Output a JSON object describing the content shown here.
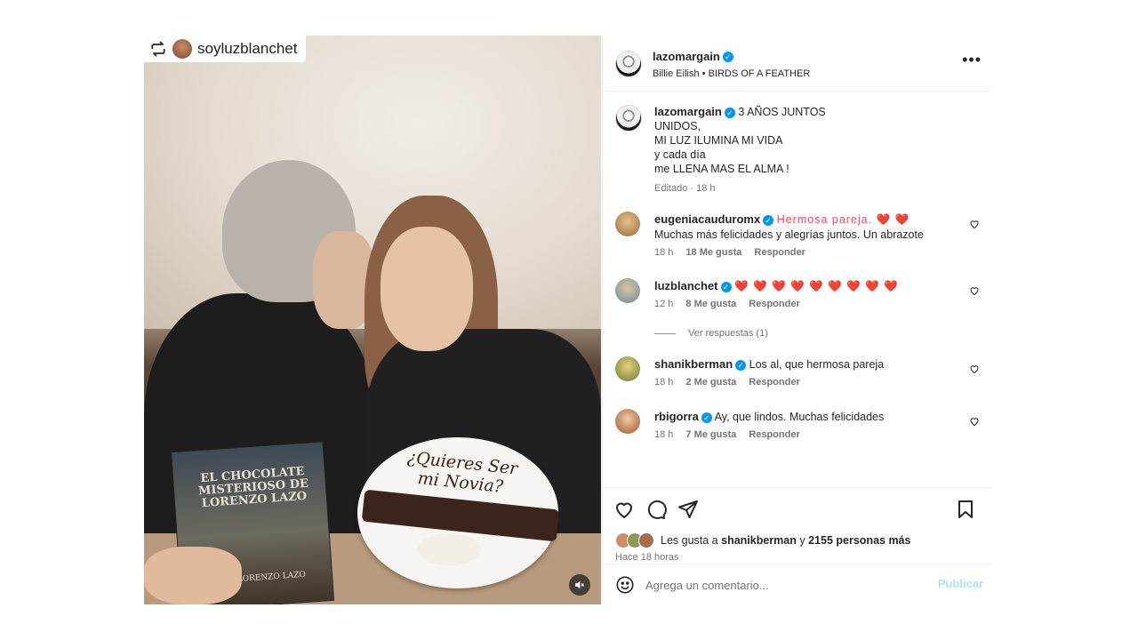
{
  "repost": {
    "username": "soyluzblanchet"
  },
  "photo": {
    "plate_text": "¿Quieres Ser mi Novia?",
    "book_title": "EL CHOCOLATE MISTERIOSO DE LORENZO LAZO",
    "book_author": "DE LORENZO LAZO"
  },
  "header": {
    "username": "lazomargain",
    "artist": "Billie Eilish",
    "song": "BIRDS OF A FEATHER",
    "separator": "•"
  },
  "caption": {
    "username": "lazomargain",
    "lines": [
      "3 AÑOS JUNTOS",
      "UNIDOS,",
      "MI LUZ ILUMINA MI VIDA",
      "y cada día",
      "me LLENA MAS EL ALMA !"
    ],
    "edited": "Editado",
    "dot": "·",
    "time": "18 h"
  },
  "comments": [
    {
      "username": "eugeniacauduromx",
      "text1": "Hermosa pareja. ❤️ ❤️",
      "text2": "Muchas más felicidades y alegrías juntos. Un abrazote",
      "time": "18 h",
      "likes": "18 Me gusta",
      "reply": "Responder"
    },
    {
      "username": "luzblanchet",
      "text1": "❤️ ❤️ ❤️ ❤️ ❤️ ❤️ ❤️ ❤️ ❤️",
      "time": "12 h",
      "likes": "8 Me gusta",
      "reply": "Responder"
    },
    {
      "username": "shanikberman",
      "text1": "Los al, que hermosa pareja",
      "time": "18 h",
      "likes": "2 Me gusta",
      "reply": "Responder"
    },
    {
      "username": "rbigorra",
      "text1": "Ay, que lindos. Muchas felicidades",
      "time": "18 h",
      "likes": "7 Me gusta",
      "reply": "Responder"
    }
  ],
  "view_replies": "Ver respuestas (1)",
  "likes": {
    "prefix": "Les gusta a",
    "user": "shanikberman",
    "conj": "y",
    "others": "2155 personas más"
  },
  "time_ago": "Hace 18 horas",
  "composer": {
    "placeholder": "Agrega un comentario...",
    "publish": "Publicar"
  },
  "colors": {
    "verified": "#0095f6",
    "heart": "#ed4956",
    "publish_disabled": "#b2dffc",
    "muted_text": "#737373"
  },
  "icons": [
    "repost-icon",
    "verified-icon",
    "more-options-icon",
    "heart-icon",
    "comment-icon",
    "share-icon",
    "save-icon",
    "emoji-icon",
    "mute-icon"
  ]
}
